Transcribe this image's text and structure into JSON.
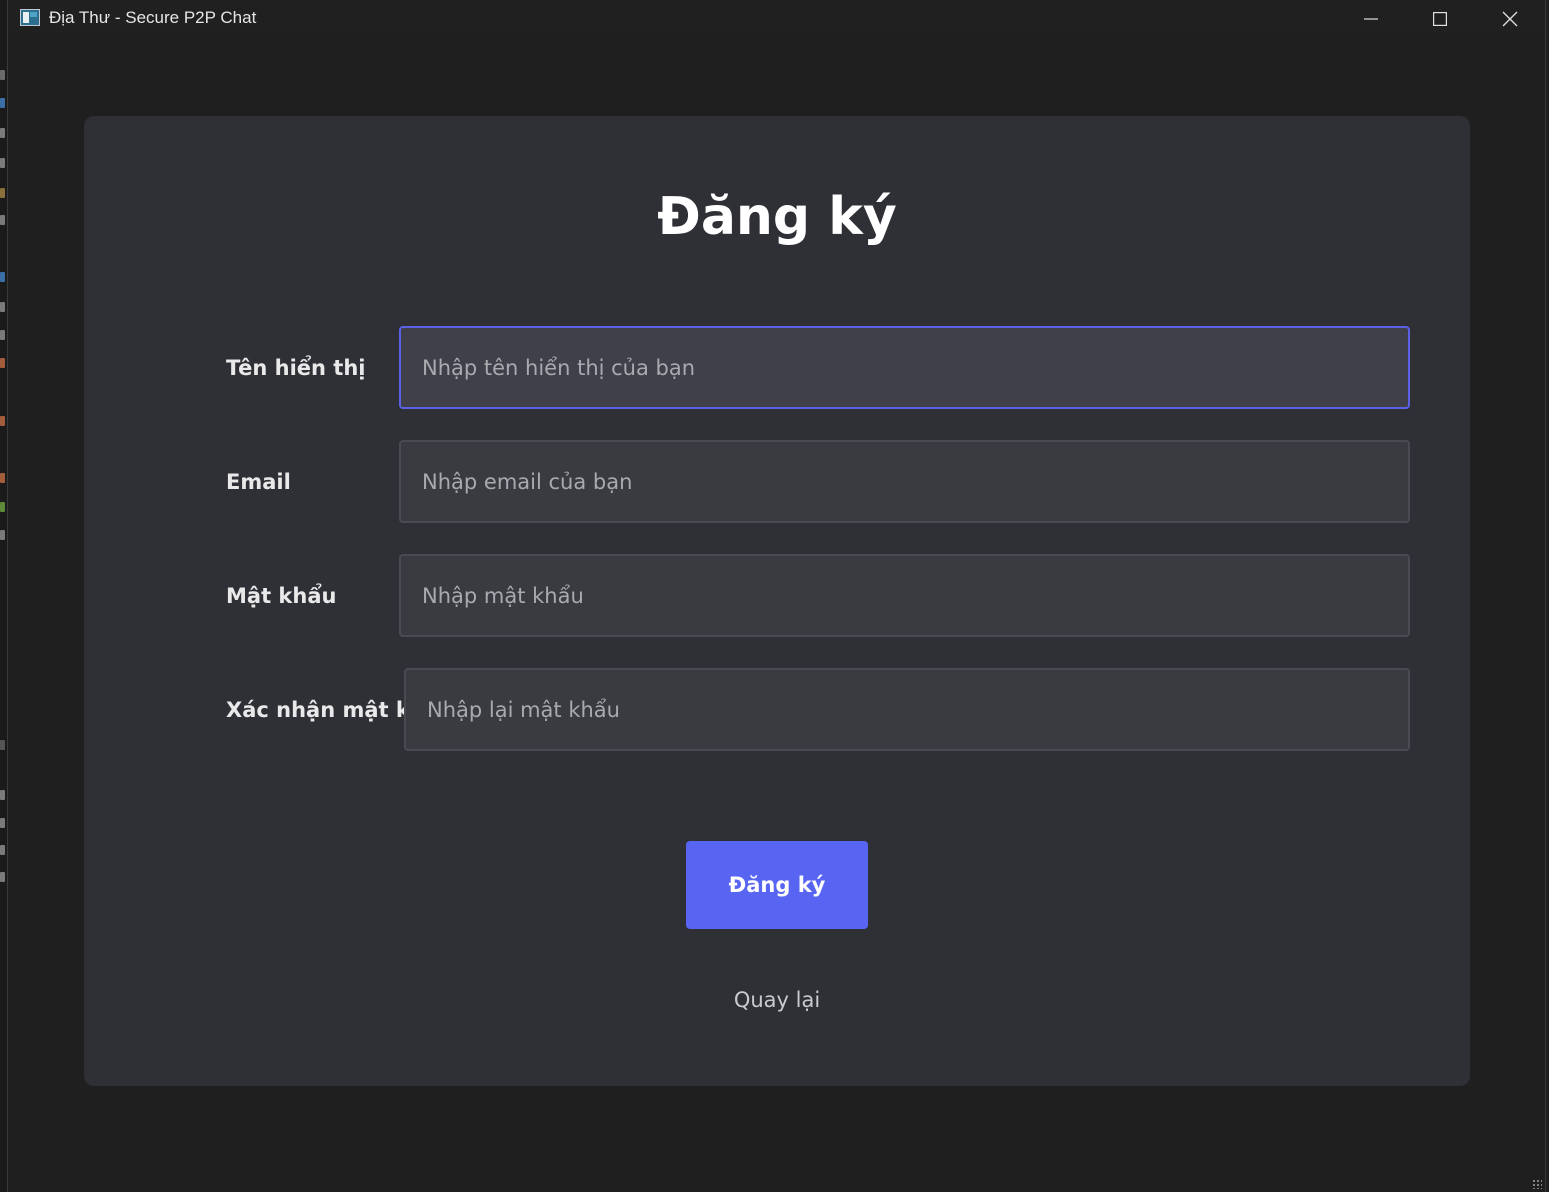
{
  "window": {
    "title": "Địa Thư - Secure P2P Chat",
    "controls": {
      "minimize": "minimize-icon",
      "maximize": "maximize-icon",
      "close": "close-icon"
    }
  },
  "form": {
    "heading": "Đăng ký",
    "fields": [
      {
        "label": "Tên hiển thị",
        "placeholder": "Nhập tên hiển thị của bạn",
        "value": "",
        "focused": true
      },
      {
        "label": "Email",
        "placeholder": "Nhập email của bạn",
        "value": "",
        "focused": false
      },
      {
        "label": "Mật khẩu",
        "placeholder": "Nhập mật khẩu",
        "value": "",
        "focused": false
      },
      {
        "label": "Xác nhận mật khẩu",
        "placeholder": "Nhập lại mật khẩu",
        "value": "",
        "focused": false
      }
    ],
    "submit_label": "Đăng ký",
    "back_label": "Quay lại"
  },
  "colors": {
    "background": "#1f1f1f",
    "card": "#2f3036",
    "input": "#3a3b41",
    "focus_border": "#5b61e6",
    "primary_button": "#5865f2"
  }
}
